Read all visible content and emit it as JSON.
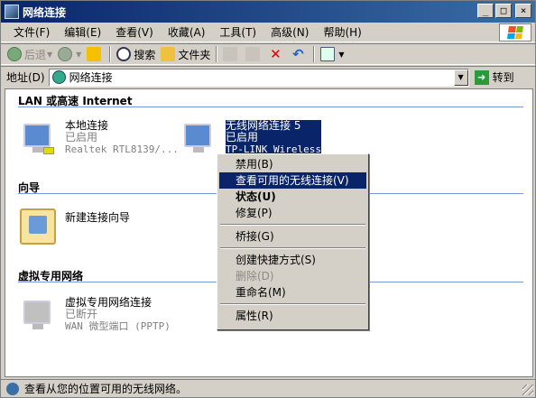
{
  "window": {
    "title": "网络连接"
  },
  "menu": [
    {
      "label": "文件(F)"
    },
    {
      "label": "编辑(E)"
    },
    {
      "label": "查看(V)"
    },
    {
      "label": "收藏(A)"
    },
    {
      "label": "工具(T)"
    },
    {
      "label": "高级(N)"
    },
    {
      "label": "帮助(H)"
    }
  ],
  "toolbar": {
    "back": "后退",
    "search": "搜索",
    "folders": "文件夹"
  },
  "address": {
    "label": "地址(D)",
    "value": "网络连接",
    "go": "转到"
  },
  "groups": {
    "lan": "LAN 或高速 Internet",
    "wizard": "向导",
    "vpn": "虚拟专用网络"
  },
  "connections": {
    "local": {
      "name": "本地连接",
      "status": "已启用",
      "detail": "Realtek RTL8139/..."
    },
    "wireless": {
      "name": "无线网络连接 5",
      "status": "已启用",
      "detail": "TP-LINK Wireless"
    },
    "wizard": {
      "name": "新建连接向导"
    },
    "vpn": {
      "name": "虚拟专用网络连接",
      "status": "已断开",
      "detail": "WAN 微型端口 (PPTP)"
    }
  },
  "context_menu": [
    {
      "label": "禁用(B)",
      "state": "normal"
    },
    {
      "label": "查看可用的无线连接(V)",
      "state": "highlighted"
    },
    {
      "label": "状态(U)",
      "state": "bold"
    },
    {
      "label": "修复(P)",
      "state": "normal"
    },
    {
      "label": "桥接(G)",
      "state": "normal"
    },
    {
      "label": "创建快捷方式(S)",
      "state": "normal"
    },
    {
      "label": "删除(D)",
      "state": "disabled"
    },
    {
      "label": "重命名(M)",
      "state": "normal"
    },
    {
      "label": "属性(R)",
      "state": "normal"
    }
  ],
  "status": {
    "text": "查看从您的位置可用的无线网络。"
  },
  "colors": {
    "selection": "#0a246a",
    "window_face": "#d4d0c8",
    "group_line": "#7a96df"
  }
}
